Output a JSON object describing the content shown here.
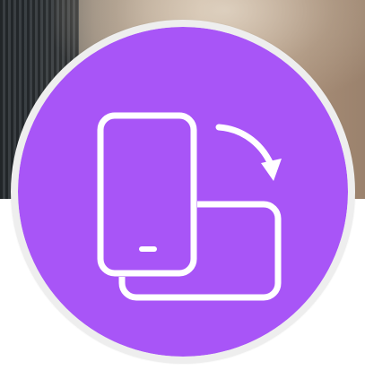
{
  "badge": {
    "icon": "screen-rotation-icon",
    "fill_color": "#a855f7",
    "ring_color": "#eeeeee",
    "stroke_color": "#ffffff"
  }
}
